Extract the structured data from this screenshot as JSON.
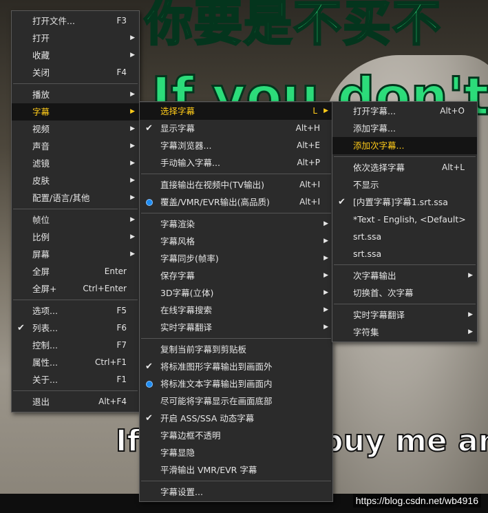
{
  "background": {
    "subtitle_cn": "你要是不买不",
    "subtitle_en_top": "If you don't",
    "subtitle_en_bottom": "If you don't buy me an",
    "watermark": "https://blog.csdn.net/wb4916"
  },
  "menu_main": [
    {
      "label": "打开文件...",
      "acc": "F3"
    },
    {
      "label": "打开",
      "sub": true
    },
    {
      "label": "收藏",
      "sub": true
    },
    {
      "label": "关闭",
      "acc": "F4"
    },
    {
      "sep": true
    },
    {
      "label": "播放",
      "sub": true
    },
    {
      "label": "字幕",
      "sub": true,
      "hl": true
    },
    {
      "label": "视频",
      "sub": true
    },
    {
      "label": "声音",
      "sub": true
    },
    {
      "label": "滤镜",
      "sub": true
    },
    {
      "label": "皮肤",
      "sub": true
    },
    {
      "label": "配置/语言/其他",
      "sub": true
    },
    {
      "sep": true
    },
    {
      "label": "帧位",
      "sub": true
    },
    {
      "label": "比例",
      "sub": true
    },
    {
      "label": "屏幕",
      "sub": true
    },
    {
      "label": "全屏",
      "acc": "Enter"
    },
    {
      "label": "全屏+",
      "acc": "Ctrl+Enter"
    },
    {
      "sep": true
    },
    {
      "label": "选项...",
      "acc": "F5"
    },
    {
      "label": "列表...",
      "acc": "F6",
      "check": true
    },
    {
      "label": "控制...",
      "acc": "F7"
    },
    {
      "label": "属性...",
      "acc": "Ctrl+F1"
    },
    {
      "label": "关于...",
      "acc": "F1"
    },
    {
      "sep": true
    },
    {
      "label": "退出",
      "acc": "Alt+F4"
    }
  ],
  "menu_subtitle": [
    {
      "label": "选择字幕",
      "acc": "L",
      "sub": true,
      "hl": true
    },
    {
      "label": "显示字幕",
      "acc": "Alt+H",
      "check": true
    },
    {
      "label": "字幕浏览器...",
      "acc": "Alt+E"
    },
    {
      "label": "手动输入字幕...",
      "acc": "Alt+P"
    },
    {
      "sep": true
    },
    {
      "label": "直接输出在视频中(TV输出)",
      "acc": "Alt+I"
    },
    {
      "label": "覆盖/VMR/EVR输出(高品质)",
      "acc": "Alt+I",
      "radio": true
    },
    {
      "sep": true
    },
    {
      "label": "字幕渲染",
      "sub": true
    },
    {
      "label": "字幕风格",
      "sub": true
    },
    {
      "label": "字幕同步(帧率)",
      "sub": true
    },
    {
      "label": "保存字幕",
      "sub": true
    },
    {
      "label": "3D字幕(立体)",
      "sub": true
    },
    {
      "label": "在线字幕搜索",
      "sub": true
    },
    {
      "label": "实时字幕翻译",
      "sub": true
    },
    {
      "sep": true
    },
    {
      "label": "复制当前字幕到剪贴板"
    },
    {
      "label": "将标准图形字幕输出到画面外",
      "check": true
    },
    {
      "label": "将标准文本字幕输出到画面内",
      "radio": true
    },
    {
      "label": "尽可能将字幕显示在画面底部"
    },
    {
      "label": "开启 ASS/SSA 动态字幕",
      "check": true
    },
    {
      "label": "字幕边框不透明"
    },
    {
      "label": "字幕显隐"
    },
    {
      "label": "平滑输出 VMR/EVR 字幕"
    },
    {
      "sep": true
    },
    {
      "label": "字幕设置..."
    }
  ],
  "menu_select": [
    {
      "label": "打开字幕...",
      "acc": "Alt+O"
    },
    {
      "label": "添加字幕..."
    },
    {
      "label": "添加次字幕...",
      "hl": true
    },
    {
      "sep": true
    },
    {
      "label": "依次选择字幕",
      "acc": "Alt+L"
    },
    {
      "label": "不显示"
    },
    {
      "label": "[内置字幕]字幕1.srt.ssa",
      "check": true
    },
    {
      "label": "*Text - English, <Default>"
    },
    {
      "label": "srt.ssa"
    },
    {
      "label": "srt.ssa"
    },
    {
      "sep": true
    },
    {
      "label": "次字幕输出",
      "sub": true
    },
    {
      "label": "切换首、次字幕"
    },
    {
      "sep": true
    },
    {
      "label": "实时字幕翻译",
      "sub": true
    },
    {
      "label": "字符集",
      "sub": true
    }
  ]
}
